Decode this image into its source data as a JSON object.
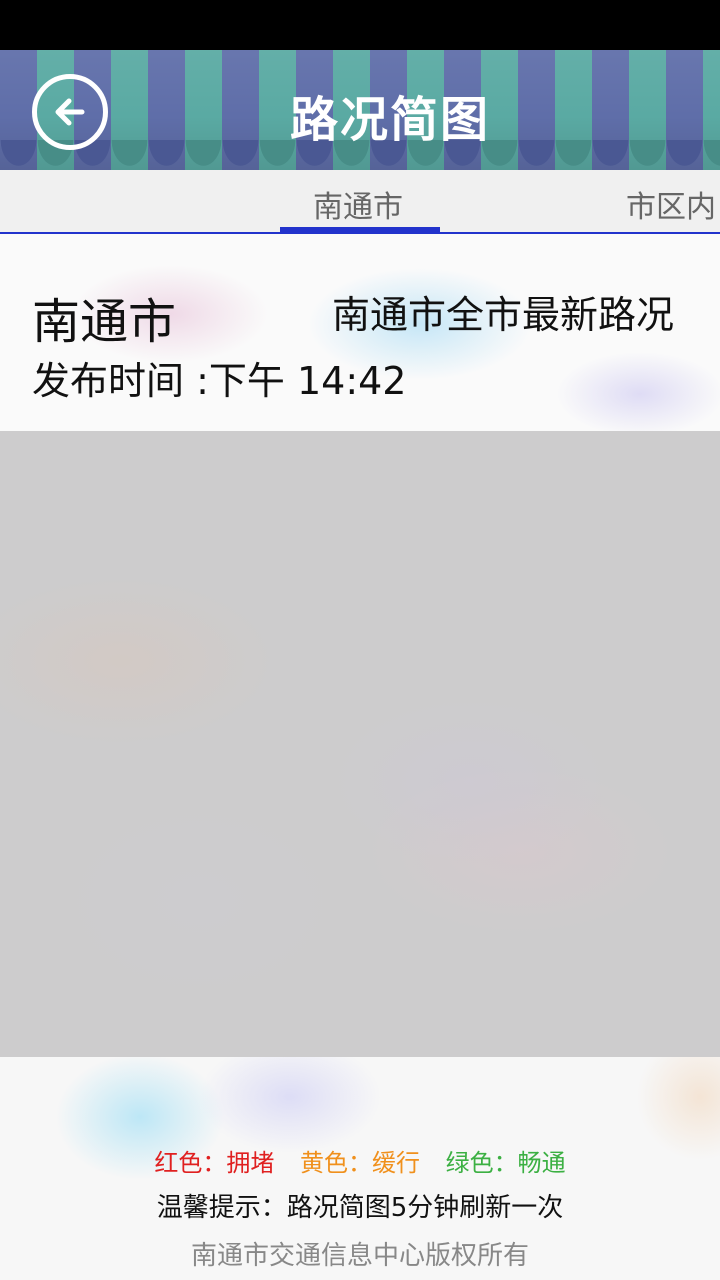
{
  "header": {
    "title": "路况简图",
    "back_icon": "back-arrow-icon"
  },
  "tabs": [
    {
      "label": "南通市",
      "selected": true
    },
    {
      "label": "市区内",
      "selected": false
    }
  ],
  "info": {
    "city": "南通市",
    "headline": "南通市全市最新路况",
    "publish_time": "发布时间 :下午 14:42"
  },
  "legend": {
    "red": "红色：拥堵",
    "yellow": "黄色：缓行",
    "green": "绿色：畅通"
  },
  "footer": {
    "tip": "温馨提示：路况简图5分钟刷新一次",
    "copyright": "南通市交通信息中心版权所有"
  },
  "colors": {
    "accent": "#2233cc",
    "congested": "#e02020",
    "slow": "#f0901c",
    "clear": "#3cb043"
  }
}
